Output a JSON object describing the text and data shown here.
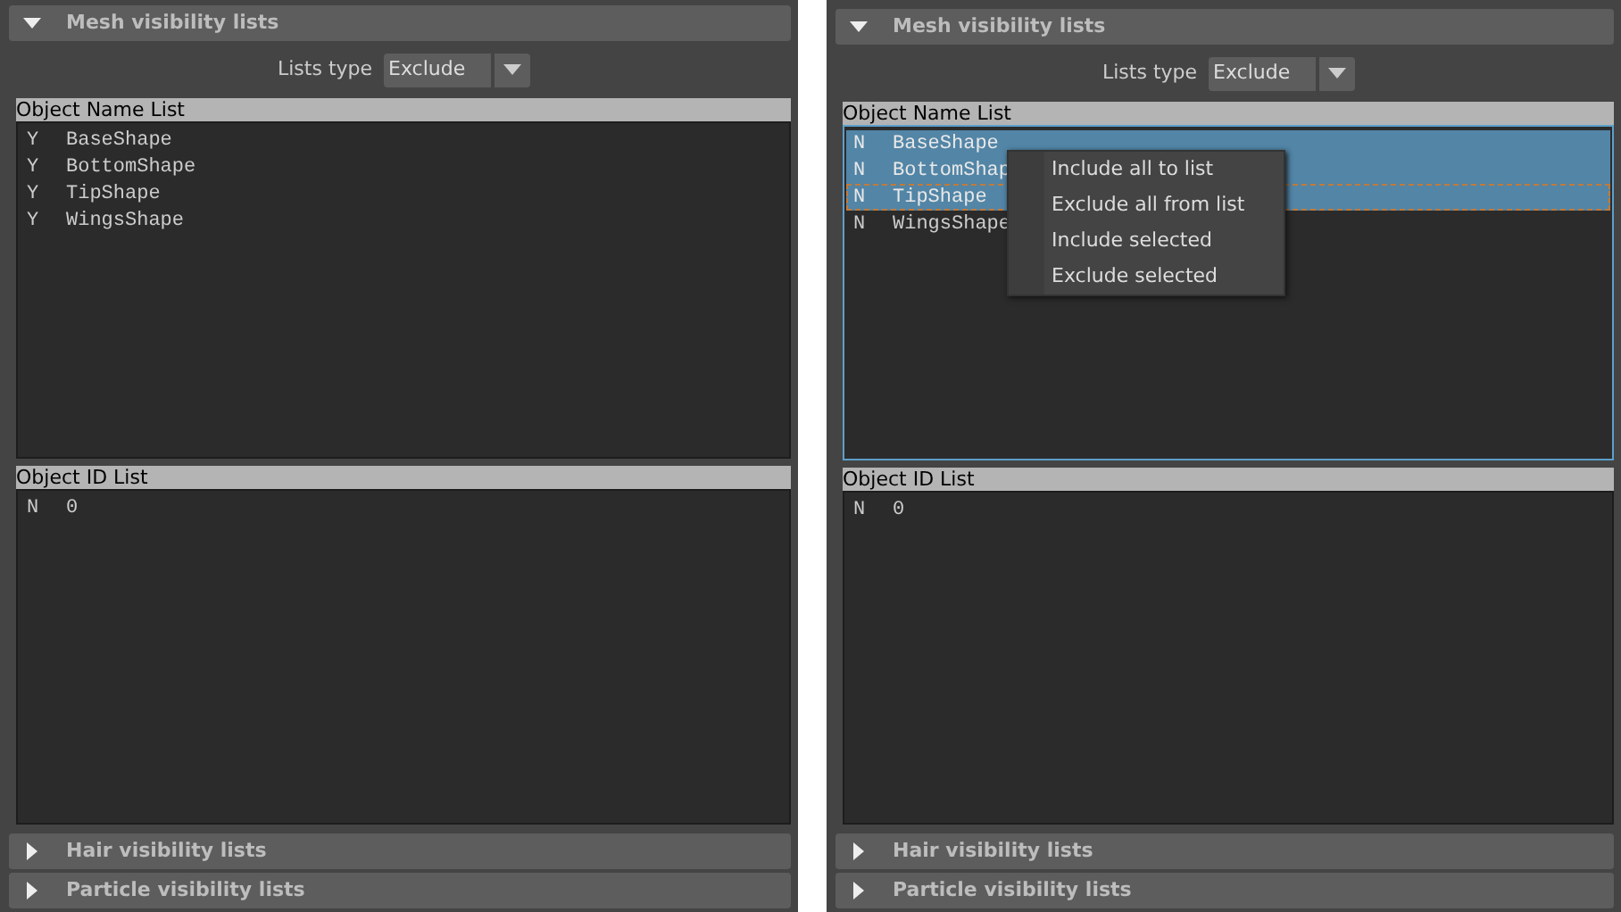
{
  "panels": [
    {
      "sections": [
        {
          "title": "Mesh visibility lists",
          "expanded": true
        },
        {
          "title": "Hair visibility lists",
          "expanded": false
        },
        {
          "title": "Particle visibility lists",
          "expanded": false
        }
      ],
      "lists_type": {
        "label": "Lists type",
        "value": "Exclude"
      },
      "lists": [
        {
          "title": "Object Name List",
          "focused": false,
          "rows": [
            {
              "flag": "Y",
              "name": "BaseShape",
              "selected": false,
              "focused": false
            },
            {
              "flag": "Y",
              "name": "BottomShape",
              "selected": false,
              "focused": false
            },
            {
              "flag": "Y",
              "name": "TipShape",
              "selected": false,
              "focused": false
            },
            {
              "flag": "Y",
              "name": "WingsShape",
              "selected": false,
              "focused": false
            }
          ]
        },
        {
          "title": "Object ID List",
          "focused": false,
          "rows": [
            {
              "flag": "N",
              "name": "0",
              "selected": false,
              "focused": false
            }
          ]
        }
      ]
    },
    {
      "sections": [
        {
          "title": "Mesh visibility lists",
          "expanded": true
        },
        {
          "title": "Hair visibility lists",
          "expanded": false
        },
        {
          "title": "Particle visibility lists",
          "expanded": false
        }
      ],
      "lists_type": {
        "label": "Lists type",
        "value": "Exclude"
      },
      "lists": [
        {
          "title": "Object Name List",
          "focused": true,
          "rows": [
            {
              "flag": "N",
              "name": "BaseShape",
              "selected": true,
              "focused": false
            },
            {
              "flag": "N",
              "name": "BottomShap",
              "selected": true,
              "focused": false
            },
            {
              "flag": "N",
              "name": "TipShape",
              "selected": true,
              "focused": true
            },
            {
              "flag": "N",
              "name": "WingsShape",
              "selected": false,
              "focused": false
            }
          ]
        },
        {
          "title": "Object ID List",
          "focused": false,
          "rows": [
            {
              "flag": "N",
              "name": "0",
              "selected": false,
              "focused": false
            }
          ]
        }
      ],
      "context_menu": {
        "items": [
          "Include all to list",
          "Exclude all from list",
          "Include selected",
          "Exclude selected"
        ]
      }
    }
  ]
}
